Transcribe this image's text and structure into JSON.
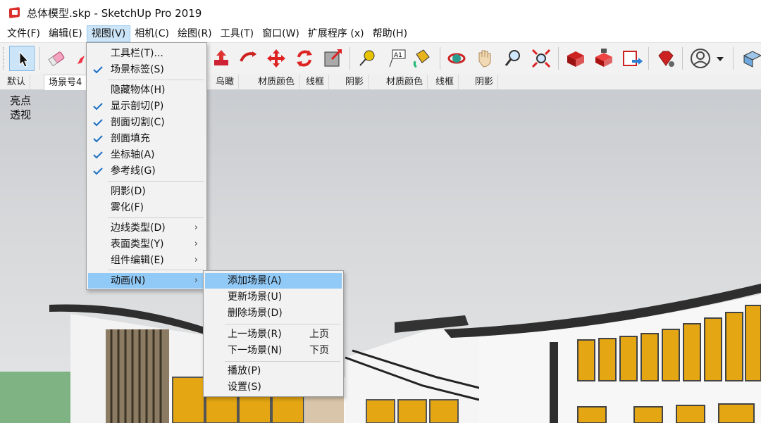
{
  "window": {
    "title": "总体模型.skp - SketchUp Pro 2019"
  },
  "menubar": {
    "items": [
      {
        "label": "文件(F)"
      },
      {
        "label": "编辑(E)"
      },
      {
        "label": "视图(V)"
      },
      {
        "label": "相机(C)"
      },
      {
        "label": "绘图(R)"
      },
      {
        "label": "工具(T)"
      },
      {
        "label": "窗口(W)"
      },
      {
        "label": "扩展程序 (x)"
      },
      {
        "label": "帮助(H)"
      }
    ]
  },
  "toolbar": {
    "tools": [
      "select-tool",
      "eraser-tool",
      "pencil-tool",
      "push-pull-tool",
      "follow-me-tool",
      "move-tool",
      "rotate-tool",
      "scale-tool",
      "tape-measure-tool",
      "text-tool",
      "paint-bucket-tool",
      "orbit-tool",
      "pan-tool",
      "zoom-tool",
      "zoom-extents-tool",
      "3d-warehouse-tool",
      "extension-warehouse-tool",
      "layout-send-tool",
      "extension-manager-tool",
      "account-tool",
      "view-tool"
    ]
  },
  "scenes": {
    "tabs": [
      {
        "label": "默认"
      },
      {
        "label": "场景号4"
      },
      {
        "label": "鸟瞰"
      },
      {
        "label": "材质颜色"
      },
      {
        "label": "线框"
      },
      {
        "label": "阴影"
      },
      {
        "label": "材质颜色"
      },
      {
        "label": "线框"
      },
      {
        "label": "阴影"
      }
    ]
  },
  "viewport": {
    "lines": [
      "亮点",
      "透视"
    ]
  },
  "view_menu": {
    "items": [
      {
        "label": "工具栏(T)...",
        "checked": false
      },
      {
        "label": "场景标签(S)",
        "checked": true
      },
      {
        "label": "隐藏物体(H)",
        "checked": false
      },
      {
        "label": "显示剖切(P)",
        "checked": true
      },
      {
        "label": "剖面切割(C)",
        "checked": true
      },
      {
        "label": "剖面填充",
        "checked": true
      },
      {
        "label": "坐标轴(A)",
        "checked": true
      },
      {
        "label": "参考线(G)",
        "checked": true
      },
      {
        "label": "阴影(D)",
        "checked": false
      },
      {
        "label": "雾化(F)",
        "checked": false
      },
      {
        "label": "边线类型(D)",
        "submenu": true
      },
      {
        "label": "表面类型(Y)",
        "submenu": true
      },
      {
        "label": "组件编辑(E)",
        "submenu": true
      },
      {
        "label": "动画(N)",
        "submenu": true,
        "highlighted": true
      }
    ]
  },
  "animation_submenu": {
    "items": [
      {
        "label": "添加场景(A)",
        "shortcut": "",
        "highlighted": true
      },
      {
        "label": "更新场景(U)",
        "shortcut": ""
      },
      {
        "label": "删除场景(D)",
        "shortcut": ""
      },
      {
        "label": "上一场景(R)",
        "shortcut": "上页"
      },
      {
        "label": "下一场景(N)",
        "shortcut": "下页"
      },
      {
        "label": "播放(P)",
        "shortcut": ""
      },
      {
        "label": "设置(S)",
        "shortcut": ""
      }
    ]
  },
  "colors": {
    "menu_highlight": "#91c9f7",
    "active_menu": "#cce4f7",
    "sketchup_red": "#d9302c",
    "building_yellow": "#e4a612"
  }
}
